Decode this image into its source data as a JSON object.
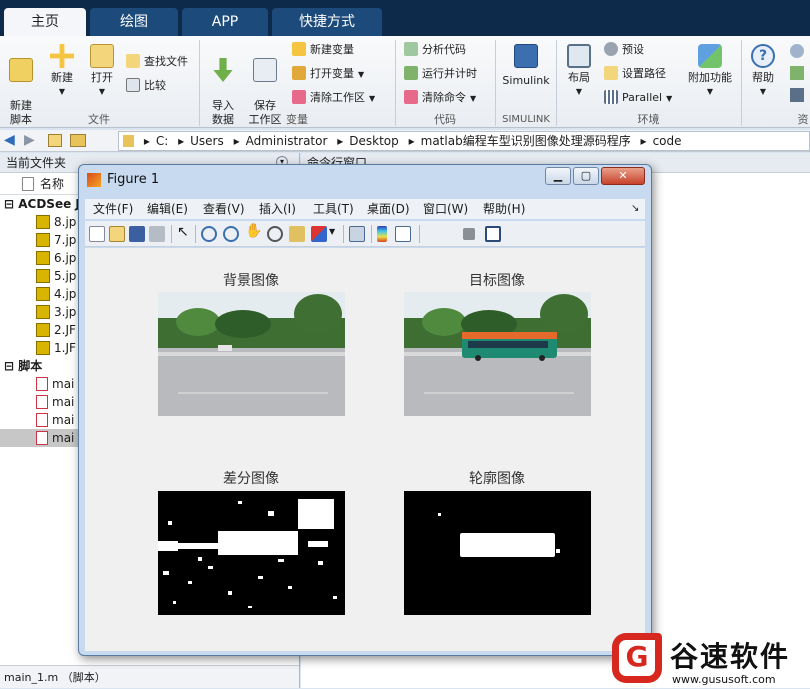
{
  "tabs": [
    "主页",
    "绘图",
    "APP",
    "快捷方式"
  ],
  "ribbon": {
    "file_group": {
      "new_script": "新建\n脚本",
      "new": "新建",
      "open": "打开",
      "find_files": "查找文件",
      "compare": "比较",
      "group_label": "文件"
    },
    "variable_group": {
      "import_data": "导入\n数据",
      "save_workspace": "保存\n工作区",
      "new_variable": "新建变量",
      "open_variable": "打开变量",
      "clear_workspace": "清除工作区",
      "group_label": "变量"
    },
    "code_group": {
      "analyze_code": "分析代码",
      "run_and_time": "运行并计时",
      "clear_commands": "清除命令",
      "group_label": "代码"
    },
    "simulink_group": {
      "simulink": "Simulink",
      "group_label": "SIMULINK"
    },
    "env_group": {
      "layout": "布局",
      "preferences": "预设",
      "set_path": "设置路径",
      "parallel": "Parallel",
      "addons": "附加功能",
      "group_label": "环境"
    },
    "help": "帮助",
    "resources_label": "资"
  },
  "address": {
    "segments": [
      "C:",
      "Users",
      "Administrator",
      "Desktop",
      "matlab编程车型识别图像处理源码程序",
      "code"
    ]
  },
  "left_panel": {
    "title": "当前文件夹",
    "column_name": "名称",
    "folder_acdsee": "ACDSee J",
    "files_jpg": [
      "8.jp",
      "7.jp",
      "6.jp",
      "5.jp",
      "4.jp",
      "3.jp",
      "2.JF",
      "1.JF"
    ],
    "folder_scripts": "脚本",
    "files_m": [
      "mai",
      "mai",
      "mai",
      "mai"
    ],
    "footer": "main_1.m （脚本）"
  },
  "right_panel": {
    "title": "命令行窗口"
  },
  "figure": {
    "title": "Figure 1",
    "menu": [
      "文件(F)",
      "编辑(E)",
      "查看(V)",
      "插入(I)",
      "工具(T)",
      "桌面(D)",
      "窗口(W)",
      "帮助(H)"
    ],
    "subplots": [
      "背景图像",
      "目标图像",
      "差分图像",
      "轮廓图像"
    ]
  },
  "watermark": {
    "name": "谷速软件",
    "url": "www.gususoft.com",
    "logo_letter": "G"
  },
  "colors": {
    "tabbar": "#0d2a4a",
    "accent": "#d6281e"
  }
}
